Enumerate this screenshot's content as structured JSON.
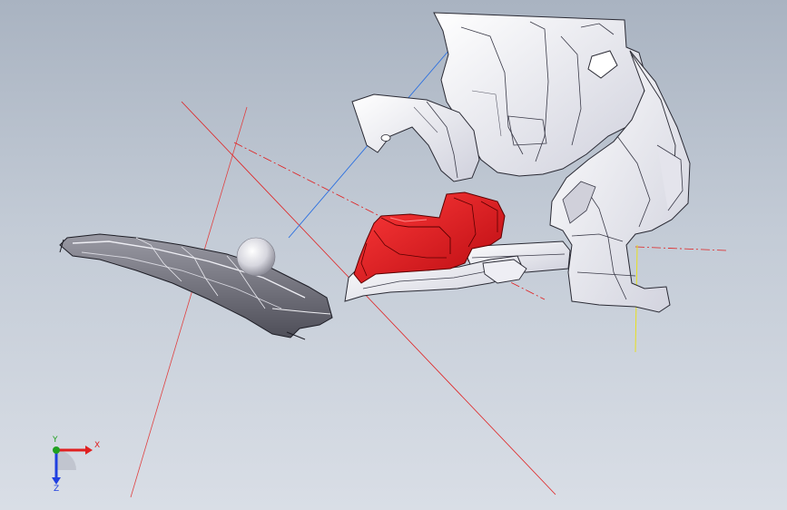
{
  "app": {
    "title": ""
  },
  "viewport": {
    "background_top": "#a9b3c1",
    "background_bottom": "#d9dee6",
    "highlight_color": "#e8141c",
    "part_color": "#f2f2f6",
    "dark_part_color": "#6e6e78",
    "sketch_red": "#e02020",
    "sketch_blue": "#2a6fe0",
    "sketch_yellow": "#e8e020"
  },
  "triad": {
    "x_label": "X",
    "y_label": "Y",
    "z_label": "Z",
    "x_color": "#e02020",
    "y_color": "#20a020",
    "z_color": "#2040e0"
  },
  "parts": [
    {
      "name": "upper-bracket-panel",
      "state": "normal"
    },
    {
      "name": "small-tab-bracket",
      "state": "normal"
    },
    {
      "name": "right-side-rail",
      "state": "normal"
    },
    {
      "name": "red-selected-panel",
      "state": "selected"
    },
    {
      "name": "left-dark-floor-pan",
      "state": "normal"
    },
    {
      "name": "sphere-marker",
      "state": "normal"
    }
  ]
}
